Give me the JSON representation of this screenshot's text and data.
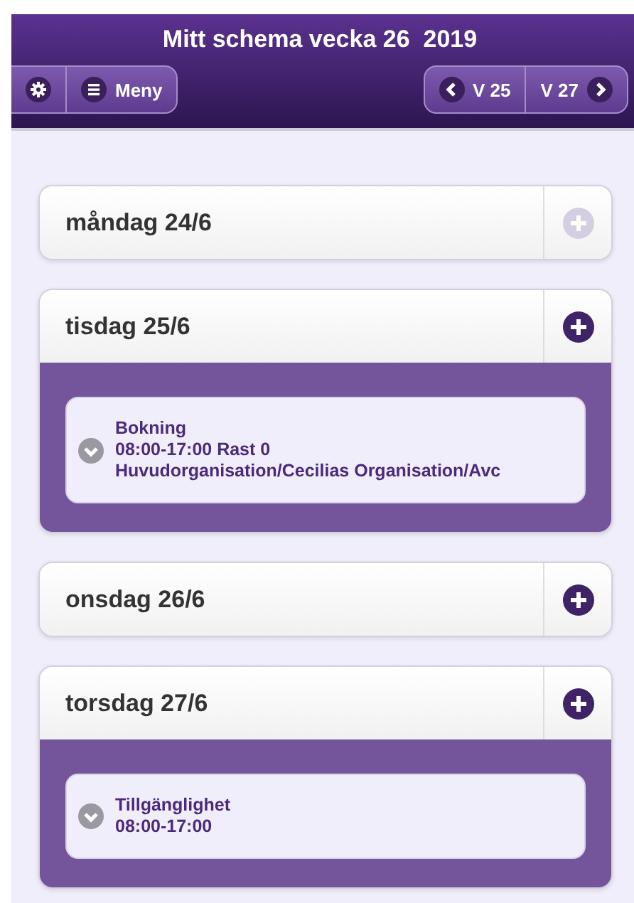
{
  "header": {
    "title": "Mitt schema vecka 26  2019",
    "menu_button": "Meny",
    "prev_week": "V 25",
    "next_week": "V 27"
  },
  "days": [
    {
      "label": "måndag 24/6",
      "add_disabled": true
    },
    {
      "label": "tisdag 25/6",
      "add_disabled": false,
      "entries": [
        {
          "title": "Bokning",
          "lines": [
            "08:00-17:00 Rast 0",
            "Huvudorganisation/Cecilias Organisation/Avc"
          ]
        }
      ]
    },
    {
      "label": "onsdag 26/6",
      "add_disabled": false
    },
    {
      "label": "torsdag 27/6",
      "add_disabled": false,
      "entries": [
        {
          "title": "Tillgänglighet",
          "lines": [
            "08:00-17:00"
          ]
        }
      ]
    }
  ]
}
